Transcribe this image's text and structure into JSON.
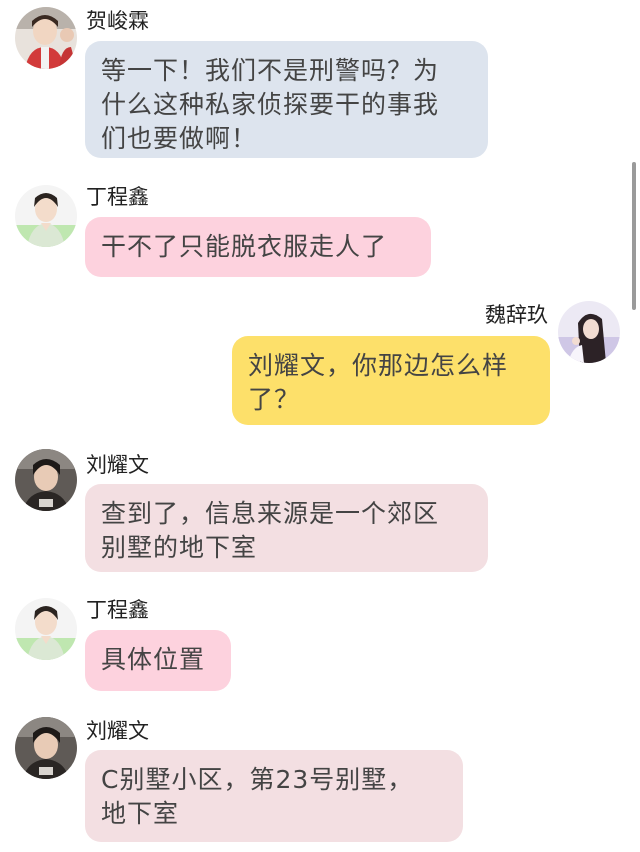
{
  "colors": {
    "bubble_he": "#dde4ee",
    "bubble_ding": "#fdd2de",
    "bubble_wei": "#fde06a",
    "bubble_liu": "#f3dfe2",
    "text": "#444444",
    "name": "#222222"
  },
  "messages": [
    {
      "sender": "贺峻霖",
      "side": "left",
      "avatar_icon": "boy-red-shirt-avatar-icon",
      "lines": [
        "等一下！我们不是刑警吗？为",
        "什么这种私家侦探要干的事我",
        "们也要做啊！"
      ]
    },
    {
      "sender": "丁程鑫",
      "side": "left",
      "avatar_icon": "boy-green-background-avatar-icon",
      "lines": [
        "干不了只能脱衣服走人了"
      ]
    },
    {
      "sender": "魏辞玖",
      "side": "right",
      "avatar_icon": "girl-long-hair-avatar-icon",
      "lines": [
        "刘耀文，你那边怎么样",
        "了？"
      ]
    },
    {
      "sender": "刘耀文",
      "side": "left",
      "avatar_icon": "boy-dark-photo-avatar-icon",
      "lines": [
        "查到了，信息来源是一个郊区",
        "别墅的地下室"
      ]
    },
    {
      "sender": "丁程鑫",
      "side": "left",
      "avatar_icon": "boy-green-background-avatar-icon",
      "lines": [
        "具体位置"
      ]
    },
    {
      "sender": "刘耀文",
      "side": "left",
      "avatar_icon": "boy-dark-photo-avatar-icon",
      "lines": [
        "C别墅小区，第23号别墅，",
        "地下室"
      ]
    }
  ]
}
